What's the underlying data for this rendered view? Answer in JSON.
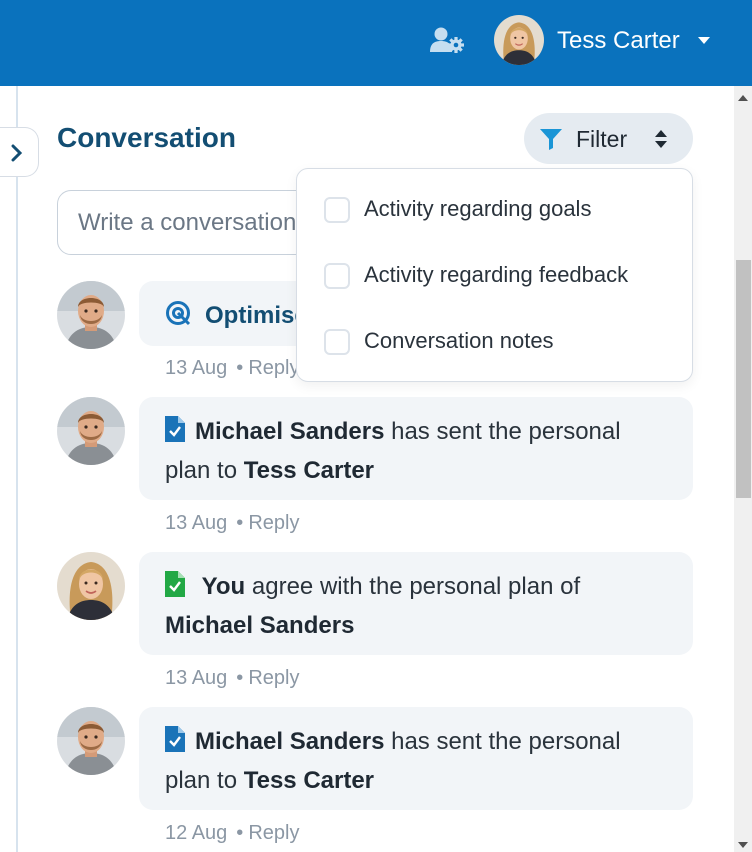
{
  "header": {
    "user_name": "Tess Carter",
    "admin_icon": "user-settings-icon",
    "brand_color": "#0a72bd"
  },
  "conversation": {
    "title": "Conversation",
    "filter_label": "Filter",
    "input_placeholder": "Write a conversation note..."
  },
  "filter_menu": {
    "options": [
      {
        "label": "Activity regarding goals",
        "checked": false
      },
      {
        "label": "Activity regarding feedback",
        "checked": false
      },
      {
        "label": "Conversation notes",
        "checked": false
      }
    ]
  },
  "feed": [
    {
      "avatar": "michael-avatar",
      "icon": "goal-target-icon",
      "text": "Optimise",
      "date": "13 Aug",
      "reply": "Reply"
    },
    {
      "avatar": "michael-avatar",
      "icon": "document-check-icon",
      "actor": "Michael Sanders",
      "action": "has sent the personal plan to",
      "target": "Tess Carter",
      "date": "13 Aug",
      "reply": "Reply"
    },
    {
      "avatar": "tess-avatar",
      "icon": "document-check-green-icon",
      "actor": "You",
      "action": "agree with the personal plan of",
      "target": "Michael Sanders",
      "date": "13 Aug",
      "reply": "Reply"
    },
    {
      "avatar": "michael-avatar",
      "icon": "document-check-icon",
      "actor": "Michael Sanders",
      "action": "has sent the personal plan to",
      "target": "Tess Carter",
      "date": "12 Aug",
      "reply": "Reply"
    }
  ]
}
